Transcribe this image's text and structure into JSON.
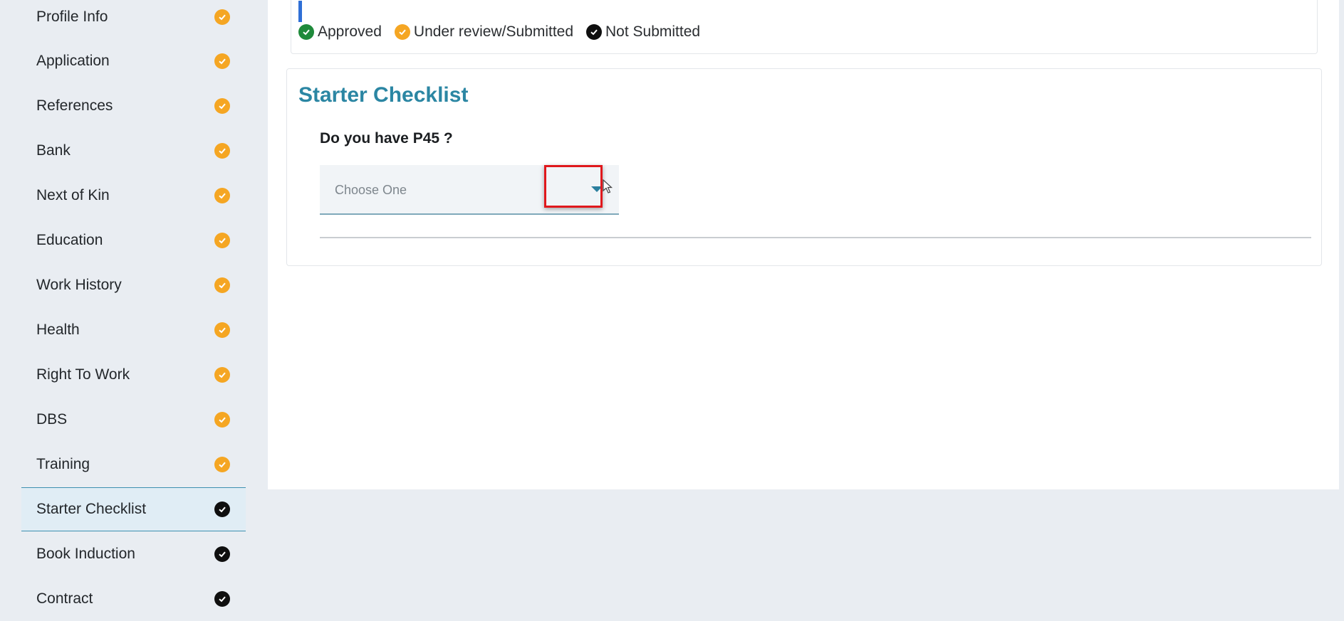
{
  "sidebar": {
    "items": [
      {
        "label": "Profile Info",
        "status": "under-review"
      },
      {
        "label": "Application",
        "status": "under-review"
      },
      {
        "label": "References",
        "status": "under-review"
      },
      {
        "label": "Bank",
        "status": "under-review"
      },
      {
        "label": "Next of Kin",
        "status": "under-review"
      },
      {
        "label": "Education",
        "status": "under-review"
      },
      {
        "label": "Work History",
        "status": "under-review"
      },
      {
        "label": "Health",
        "status": "under-review"
      },
      {
        "label": "Right To Work",
        "status": "under-review"
      },
      {
        "label": "DBS",
        "status": "under-review"
      },
      {
        "label": "Training",
        "status": "under-review"
      },
      {
        "label": "Starter Checklist",
        "status": "not-submitted",
        "active": true
      },
      {
        "label": "Book Induction",
        "status": "not-submitted"
      },
      {
        "label": "Contract",
        "status": "not-submitted"
      }
    ]
  },
  "legend": {
    "approved": "Approved",
    "under_review": "Under review/Submitted",
    "not_submitted": "Not Submitted"
  },
  "checklist": {
    "title": "Starter Checklist",
    "question": "Do you have P45 ?",
    "select_placeholder": "Choose One"
  },
  "colors": {
    "approved": "#1f8a3b",
    "under_review": "#f5a623",
    "not_submitted": "#0f0f0f",
    "accent": "#2b86a3",
    "highlight": "#e0181c"
  },
  "icons": {
    "status": "check-circle-icon",
    "dropdown": "caret-down-icon",
    "pointer": "mouse-cursor-icon"
  }
}
